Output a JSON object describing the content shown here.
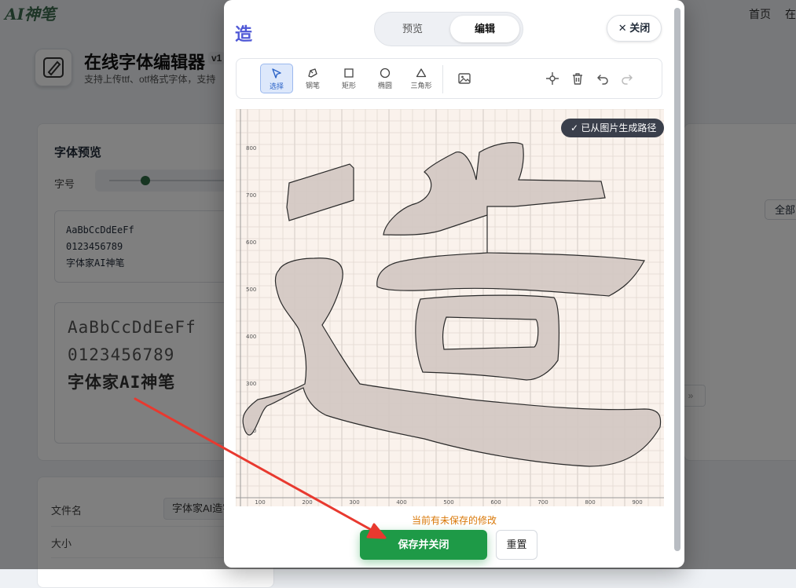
{
  "background": {
    "logo": "AI神笔",
    "nav": [
      "首页",
      "在"
    ],
    "app_title": "在线字体编辑器",
    "app_version": "v1",
    "app_subtitle": "支持上传ttf、otf格式字体，支持",
    "preview_card": {
      "title": "字体预览",
      "size_label": "字号",
      "sample_small": [
        "AaBbCcDdEeFf",
        "0123456789",
        "字体家AI神笔"
      ],
      "sample_large": [
        "AaBbCcDdEeFf",
        "0123456789",
        "字体家AI神笔"
      ]
    },
    "info_card": {
      "filename_label": "文件名",
      "filename_value": "字体家AI造字",
      "size_label": "大小"
    },
    "filter_all": "全部",
    "page_next": "»"
  },
  "modal": {
    "glyph": "造",
    "tabs": [
      {
        "label": "预览",
        "active": false
      },
      {
        "label": "编辑",
        "active": true
      }
    ],
    "close_label": "关闭",
    "tools": [
      {
        "label": "选择",
        "icon": "cursor-icon",
        "selected": true
      },
      {
        "label": "钢笔",
        "icon": "pen-icon",
        "selected": false
      },
      {
        "label": "矩形",
        "icon": "rectangle-icon",
        "selected": false
      },
      {
        "label": "椭圆",
        "icon": "ellipse-icon",
        "selected": false
      },
      {
        "label": "三角形",
        "icon": "triangle-icon",
        "selected": false
      }
    ],
    "action_icons": [
      "image-icon",
      "center-icon",
      "trash-icon",
      "undo-icon",
      "redo-icon"
    ],
    "badge": "已从图片生成路径",
    "y_ticks": [
      "800",
      "700",
      "600",
      "500",
      "400",
      "300",
      "200"
    ],
    "x_ticks": [
      "100",
      "200",
      "300",
      "400",
      "500",
      "600",
      "700",
      "800",
      "900"
    ],
    "unsaved_notice": "当前有未保存的修改",
    "save_label": "保存并关闭",
    "reset_label": "重置",
    "colors": {
      "accent": "#4f58d6",
      "save": "#1e9a47",
      "glyph_fill": "#d1c6c2",
      "notice": "#d97706"
    }
  }
}
